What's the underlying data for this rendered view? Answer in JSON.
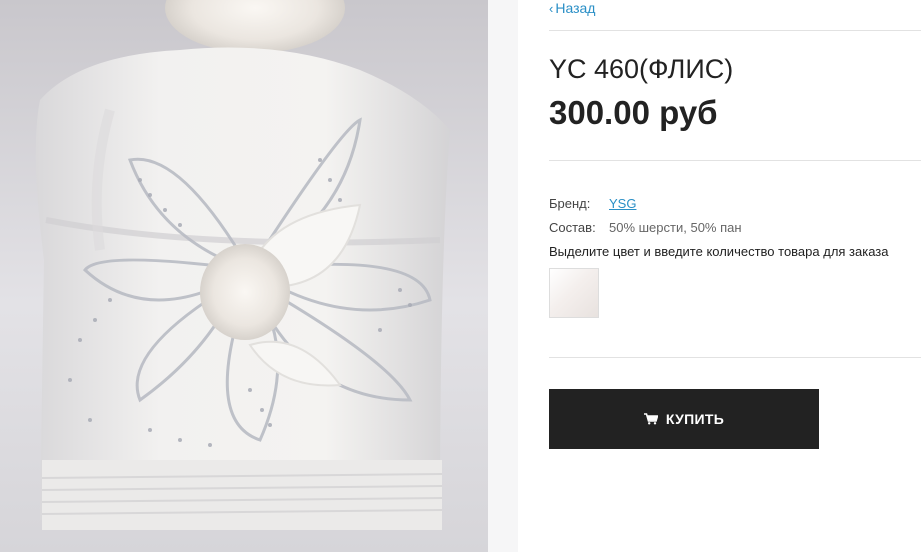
{
  "nav": {
    "back_label": "Назад"
  },
  "product": {
    "title": "YC 460(ФЛИС)",
    "price": "300.00 руб",
    "brand_label": "Бренд:",
    "brand_value": "YSG",
    "composition_label": "Состав:",
    "composition_value": "50% шерсти, 50% пан",
    "color_hint": "Выделите цвет и введите количество товара для заказа",
    "swatch_color": "#f2ecea"
  },
  "actions": {
    "buy_label": "КУПИТЬ",
    "buy_icon": "shopping-cart-icon"
  },
  "colors": {
    "link": "#2a8fc6",
    "button_bg": "#222222",
    "text": "#222222"
  }
}
